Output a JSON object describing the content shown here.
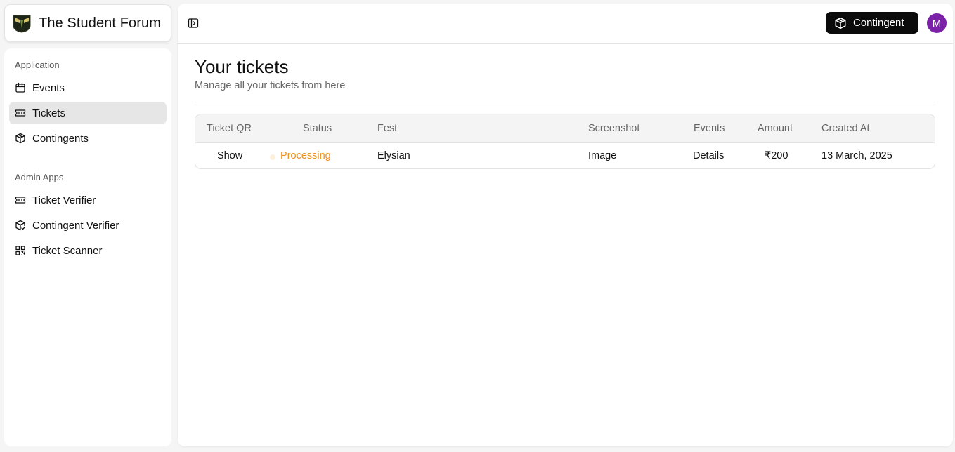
{
  "brand": {
    "title": "The Student Forum"
  },
  "sidebar": {
    "groups": [
      {
        "label": "Application",
        "items": [
          {
            "label": "Events",
            "icon": "calendar-icon"
          },
          {
            "label": "Tickets",
            "icon": "ticket-icon",
            "active": true
          },
          {
            "label": "Contingents",
            "icon": "package-icon"
          }
        ]
      },
      {
        "label": "Admin Apps",
        "items": [
          {
            "label": "Ticket Verifier",
            "icon": "ticket-icon"
          },
          {
            "label": "Contingent Verifier",
            "icon": "package-check-icon"
          },
          {
            "label": "Ticket Scanner",
            "icon": "qr-code-icon"
          }
        ]
      }
    ]
  },
  "topbar": {
    "contingent_button": "Contingent",
    "avatar_initial": "M",
    "avatar_color": "#7b22a8"
  },
  "page": {
    "title": "Your tickets",
    "subtitle": "Manage all your tickets from here"
  },
  "table": {
    "columns": [
      "Ticket QR",
      "Status",
      "Fest",
      "Screenshot",
      "Events",
      "Amount",
      "Created At"
    ],
    "rows": [
      {
        "ticket_qr": "Show",
        "status": "Processing",
        "fest": "Elysian",
        "screenshot": "Image",
        "events": "Details",
        "amount": "₹200",
        "created_at": "13 March, 2025"
      }
    ]
  },
  "colors": {
    "status_processing": "#ee8f1c",
    "active_nav_bg": "#e6e6e6",
    "button_dark": "#0b0b0b"
  }
}
